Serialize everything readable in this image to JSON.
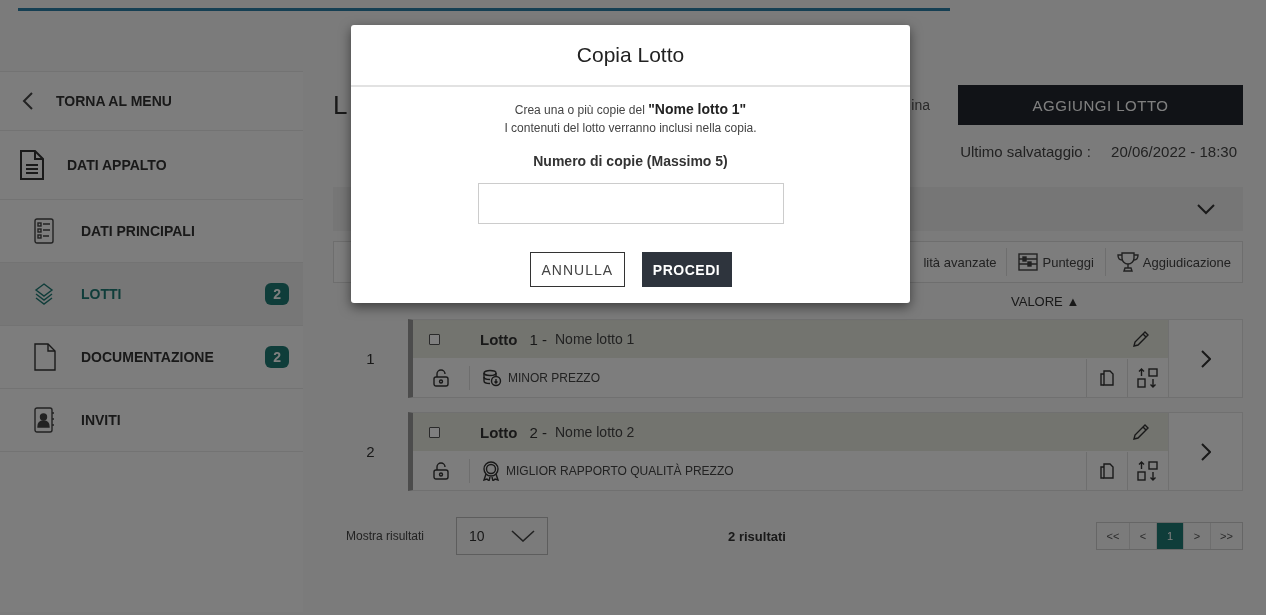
{
  "sidebar": {
    "back": "TORNA AL MENU",
    "sections": [
      {
        "label": "DATI APPALTO",
        "children": [
          {
            "label": "DATI PRINCIPALI",
            "selected": false
          },
          {
            "label": "LOTTI",
            "selected": true,
            "badge": "2"
          },
          {
            "label": "DOCUMENTAZIONE",
            "selected": false,
            "badge": "2"
          },
          {
            "label": "INVITI",
            "selected": false
          }
        ]
      }
    ]
  },
  "page": {
    "title": "L",
    "note": "ina",
    "add_button": "AGGIUNGI LOTTO",
    "last_save_label": "Ultimo salvataggio :",
    "last_save_value": "20/06/2022 - 18:30"
  },
  "toolbar": [
    "lità avanzate",
    "Punteggi",
    "Aggiudicazione"
  ],
  "table": {
    "value_header": "VALORE ▲",
    "rows": [
      {
        "number": "1",
        "checked": false,
        "title": "Lotto",
        "index": "1 -",
        "name": "Nome lotto 1",
        "criterion": "MINOR PREZZO"
      },
      {
        "number": "2",
        "checked": false,
        "title": "Lotto",
        "index": "2 -",
        "name": "Nome lotto 2",
        "criterion": "MIGLIOR RAPPORTO QUALITÀ PREZZO"
      }
    ]
  },
  "footer": {
    "show_label": "Mostra risultati",
    "page_size": "10",
    "count": "2 risultati",
    "pages": [
      {
        "label": "<<",
        "selected": false
      },
      {
        "label": "<",
        "selected": false
      },
      {
        "label": "1",
        "selected": true
      },
      {
        "label": ">",
        "selected": false
      },
      {
        "label": ">>",
        "selected": false
      }
    ]
  },
  "modal": {
    "title": "Copia Lotto",
    "message": "Crea una o più copie del **\"Nome lotto 1\"**",
    "note": "I contenuti del lotto verranno inclusi nella copia.",
    "field_label": "Numero di copie (Massimo 5)",
    "buttons": [
      {
        "label": "ANNULLA",
        "kind": "secondary"
      },
      {
        "label": "PROCEDI",
        "kind": "primary"
      }
    ]
  }
}
